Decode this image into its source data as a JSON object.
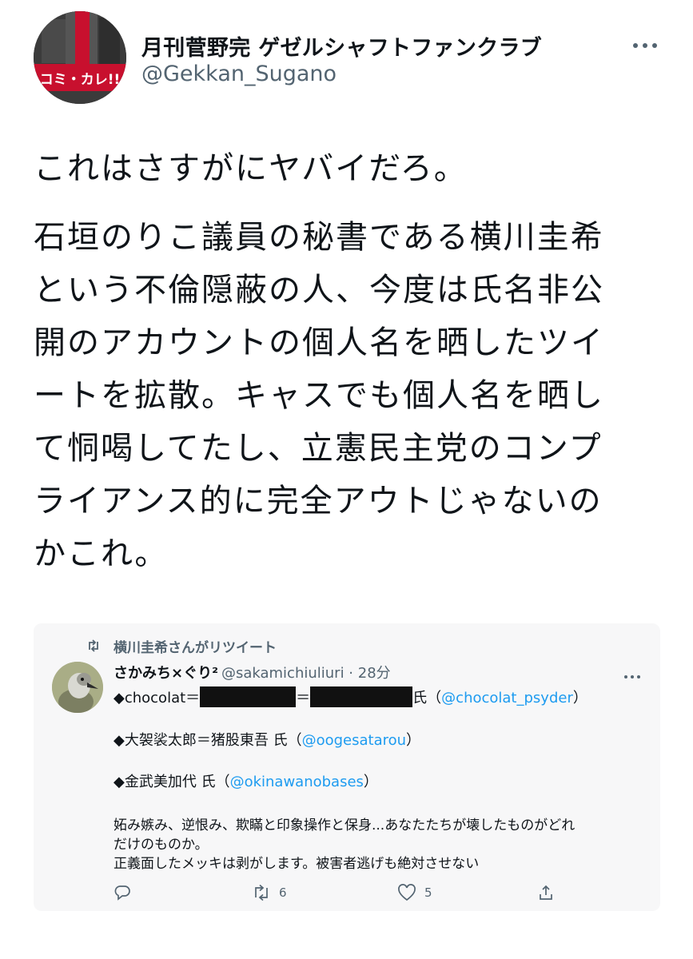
{
  "tweet": {
    "author_name": "月刊菅野完 ゲゼルシャフトファンクラブ",
    "author_handle": "@Gekkan_Sugano",
    "avatar_caption": "コミ・カレ!!",
    "text_line_1": "これはさすがにヤバイだろ。",
    "text_lines_2": [
      "石垣のりこ議員の秘書である横川圭希",
      "という不倫隠蔽の人、今度は氏名非公",
      "開のアカウントの個人名を晒したツイ",
      "ートを拡散。キャスでも個人名を晒し",
      "て恫喝してたし、立憲民主党のコンプ",
      "ライアンス的に完全アウトじゃないの",
      "かこれ。"
    ]
  },
  "quoted": {
    "retweet_label": "横川圭希さんがリツイート",
    "author_name": "さかみち×ぐり²",
    "author_meta": "@sakamichiuliuri · 28分",
    "line1_prefix": "◆chocolat＝",
    "line1_mid": "＝",
    "line1_suffix": "氏（",
    "line1_link": "@chocolat_psyder",
    "line1_close": "）",
    "line2_prefix": "◆大袈裟太郎＝猪股東吾 氏（",
    "line2_link": "@oogesatarou",
    "line2_close": "）",
    "line3_prefix": "◆金武美加代 氏（",
    "line3_link": "@okinawanobases",
    "line3_close": "）",
    "body_line_a": "妬み嫉み、逆恨み、欺瞞と印象操作と保身...あなたたちが壊したものがどれ",
    "body_line_b": "だけのものか。",
    "body_line_c": "正義面したメッキは剥がします。被害者逃げも絶対させない",
    "retweet_count": "6",
    "like_count": "5"
  },
  "colors": {
    "link": "#1d9bf0",
    "muted": "#536471",
    "text": "#0f1419",
    "card_bg": "#f7f7f8"
  },
  "icons": [
    "more-icon",
    "retweet-icon",
    "reply-icon",
    "like-icon",
    "share-icon"
  ]
}
